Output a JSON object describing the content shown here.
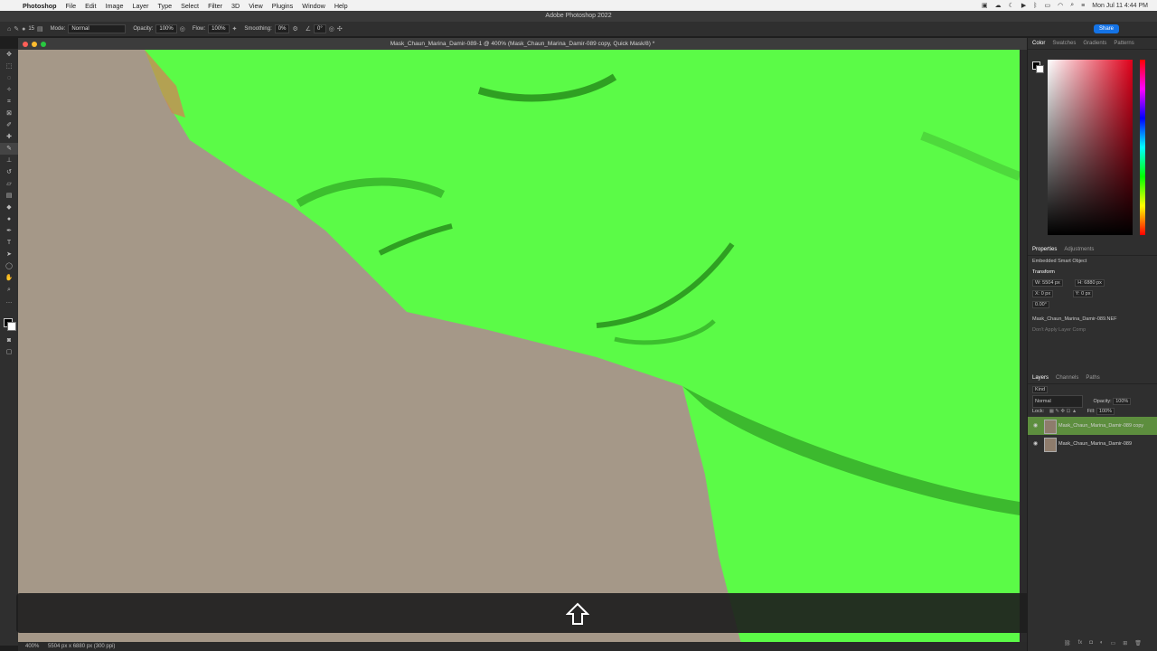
{
  "menubar": {
    "app": "Photoshop",
    "items": [
      "File",
      "Edit",
      "Image",
      "Layer",
      "Type",
      "Select",
      "Filter",
      "3D",
      "View",
      "Plugins",
      "Window",
      "Help"
    ],
    "datetime": "Mon Jul 11  4:44 PM"
  },
  "window": {
    "title": "Adobe Photoshop 2022"
  },
  "options": {
    "brush_size": "15",
    "mode_label": "Mode:",
    "mode_value": "Normal",
    "opacity_label": "Opacity:",
    "opacity_value": "100%",
    "flow_label": "Flow:",
    "flow_value": "100%",
    "smoothing_label": "Smoothing:",
    "smoothing_value": "0%",
    "angle_value": "0°",
    "share_label": "Share"
  },
  "document": {
    "tab_title": "Mask_Chaun_Marina_Damir-089-1 @ 400% (Mask_Chaun_Marina_Damir-089 copy, Quick Mask/8) *",
    "zoom": "400%",
    "doc_info": "5504 px x 6880 px (300 ppi)"
  },
  "color_panel": {
    "tabs": [
      "Color",
      "Swatches",
      "Gradients",
      "Patterns"
    ]
  },
  "properties": {
    "tabs": [
      "Properties",
      "Adjustments"
    ],
    "object_type": "Embedded Smart Object",
    "section": "Transform",
    "w": "W: 5504 px",
    "h": "H: 6880 px",
    "x": "X: 0 px",
    "y": "Y: 0 px",
    "angle": "0.00°",
    "filename": "Mask_Chaun_Marina_Damir-089.NEF",
    "layer_comps_placeholder": "Don't Apply Layer Comp"
  },
  "layers_panel": {
    "tabs": [
      "Layers",
      "Channels",
      "Paths"
    ],
    "filter_kind": "Kind",
    "blend_mode": "Normal",
    "opacity_label": "Opacity:",
    "opacity_value": "100%",
    "lock_label": "Lock:",
    "fill_label": "Fill:",
    "fill_value": "100%",
    "layers": [
      {
        "name": "Mask_Chaun_Marina_Damir-089 copy",
        "selected": true
      },
      {
        "name": "Mask_Chaun_Marina_Damir-089",
        "selected": false
      }
    ]
  },
  "colors": {
    "mask_green": "#55ff44",
    "accent_blue": "#1473e6",
    "skin_bg": "#a49787"
  }
}
